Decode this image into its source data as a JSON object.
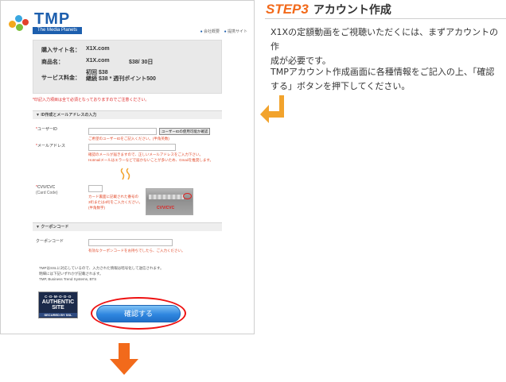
{
  "site": {
    "logo_text": "TMP",
    "logo_sub": "The Media Planets",
    "links": [
      "会社概要",
      "提携サイト"
    ]
  },
  "summary": {
    "site_label": "購入サイト名：",
    "site_value": "X1X.com",
    "product_label": "商品名：",
    "product_value": "X1X.com",
    "product_price": "$38/ 30日",
    "fee_label": "サービス料金：",
    "fee_line1": "初回  $38",
    "fee_line2": "継続  $38 * 週刊ポイント500"
  },
  "form": {
    "required_note": "*印記入力項目は全て必須となっておりますのでご注意ください。",
    "section1_title": "▼ ID作成とメールアドレスの入力",
    "userid_label": "ユーザーID",
    "userid_button": "ユーザーIDの使用可能か確認",
    "userid_hint": "ご希望のユーザーIDをご記入ください。(半角英数)",
    "email_label": "メールアドレス",
    "email_hint1": "確認のメールが届きますので、正しいメールアドレスをご入力下さい。",
    "email_hint2": "Hotmailメールはエラーなどで届かないことが多いため、Gmailを推奨します。",
    "cvv_label": "CVV/CVC",
    "cvv_sub": "(Card Code)",
    "cvv_hint1": "カード裏面に記載された番号の",
    "cvv_hint2": "3桁または4桁をご入力ください。",
    "cvv_hint3": "(半角数字)",
    "card_cvv_label": "CVV/CVC",
    "section2_title": "▼ クーポンコード",
    "coupon_label": "クーポンコード",
    "coupon_hint": "有効なクーポンコードをお持ちでしたら、ご入力ください。",
    "secure_line1": "TMPはSSLに対応しているので、入力された情報は暗号化して送信されます。",
    "secure_line2": "明細には下記いずれかが記載されます。",
    "secure_line3": "TMP, Business Trend Systems, BTS",
    "badge_line1": "C·O·M·O·D·O",
    "badge_line2": "AUTHENTIC",
    "badge_line3": "SITE",
    "badge_line4": "SECURED BY SSL",
    "confirm_button": "確認する"
  },
  "step": {
    "label": "STEP3",
    "title": "アカウント作成",
    "para1_line1": "X1Xの定額動画をご視聴いただくには、まずアカウントの作",
    "para1_line2": "成が必要です。",
    "para2_line1": "TMPアカウント作成画面に各種情報をご記入の上、「確認",
    "para2_line2": "する」ボタンを押下してください。"
  },
  "colors": {
    "accent_orange": "#f26a1b",
    "brand_blue": "#1d5fae",
    "required_red": "#dd2222"
  }
}
